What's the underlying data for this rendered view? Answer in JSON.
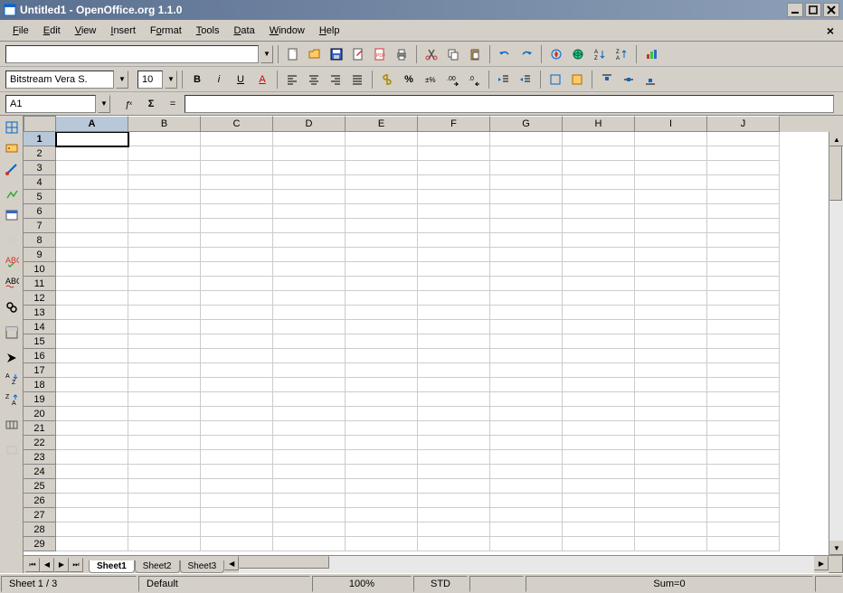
{
  "window": {
    "title": "Untitled1 - OpenOffice.org 1.1.0"
  },
  "menu": {
    "items": [
      "File",
      "Edit",
      "View",
      "Insert",
      "Format",
      "Tools",
      "Data",
      "Window",
      "Help"
    ],
    "accel": [
      "F",
      "E",
      "V",
      "I",
      "o",
      "T",
      "D",
      "W",
      "H"
    ]
  },
  "toolbar1": {
    "url": ""
  },
  "format": {
    "font_name": "Bitstream Vera S.",
    "font_size": "10"
  },
  "formula": {
    "cell_ref": "A1",
    "equals": "="
  },
  "columns": [
    "A",
    "B",
    "C",
    "D",
    "E",
    "F",
    "G",
    "H",
    "I",
    "J"
  ],
  "rows": [
    1,
    2,
    3,
    4,
    5,
    6,
    7,
    8,
    9,
    10,
    11,
    12,
    13,
    14,
    15,
    16,
    17,
    18,
    19,
    20,
    21,
    22,
    23,
    24,
    25,
    26,
    27,
    28,
    29
  ],
  "active_cell": {
    "col": 0,
    "row": 0
  },
  "sheets": {
    "tabs": [
      "Sheet1",
      "Sheet2",
      "Sheet3"
    ],
    "active": 0
  },
  "status": {
    "sheet": "Sheet 1 / 3",
    "style": "Default",
    "zoom": "100%",
    "mode": "STD",
    "sum": "Sum=0"
  }
}
